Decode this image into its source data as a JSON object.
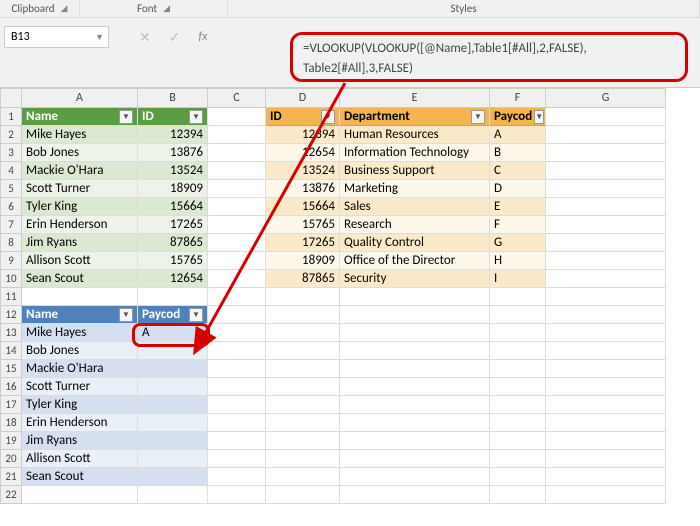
{
  "ribbon": {
    "g1": "Clipboard",
    "g2": "Font",
    "g3": "Styles"
  },
  "namebox": {
    "ref": "B13"
  },
  "fx": {
    "label": "fx"
  },
  "formula": {
    "line1": "=VLOOKUP(VLOOKUP([@Name],Table1[#All],2,FALSE),",
    "line2": "Table2[#All],3,FALSE)"
  },
  "cols": [
    "A",
    "B",
    "C",
    "D",
    "E",
    "F",
    "G"
  ],
  "table1": {
    "hdrName": "Name",
    "hdrId": "ID",
    "rows": [
      {
        "name": "Mike Hayes",
        "id": "12394"
      },
      {
        "name": "Bob Jones",
        "id": "13876"
      },
      {
        "name": "Mackie O'Hara",
        "id": "13524"
      },
      {
        "name": "Scott Turner",
        "id": "18909"
      },
      {
        "name": "Tyler King",
        "id": "15664"
      },
      {
        "name": "Erin Henderson",
        "id": "17265"
      },
      {
        "name": "Jim Ryans",
        "id": "87865"
      },
      {
        "name": "Allison Scott",
        "id": "15765"
      },
      {
        "name": "Sean Scout",
        "id": "12654"
      }
    ]
  },
  "table2": {
    "hdrId": "ID",
    "hdrDept": "Department",
    "hdrPay": "Paycod",
    "rows": [
      {
        "id": "12394",
        "dept": "Human Resources",
        "pay": "A"
      },
      {
        "id": "12654",
        "dept": "Information Technology",
        "pay": "B"
      },
      {
        "id": "13524",
        "dept": "Business Support",
        "pay": "C"
      },
      {
        "id": "13876",
        "dept": "Marketing",
        "pay": "D"
      },
      {
        "id": "15664",
        "dept": "Sales",
        "pay": "E"
      },
      {
        "id": "15765",
        "dept": "Research",
        "pay": "F"
      },
      {
        "id": "17265",
        "dept": "Quality Control",
        "pay": "G"
      },
      {
        "id": "18909",
        "dept": "Office of the Director",
        "pay": "H"
      },
      {
        "id": "87865",
        "dept": "Security",
        "pay": "I"
      }
    ]
  },
  "table3": {
    "hdrName": "Name",
    "hdrPay": "Paycod",
    "resultVal": "A",
    "rows": [
      {
        "name": "Mike Hayes"
      },
      {
        "name": "Bob Jones"
      },
      {
        "name": "Mackie O'Hara"
      },
      {
        "name": "Scott Turner"
      },
      {
        "name": "Tyler King"
      },
      {
        "name": "Erin Henderson"
      },
      {
        "name": "Jim Ryans"
      },
      {
        "name": "Allison Scott"
      },
      {
        "name": "Sean Scout"
      }
    ]
  }
}
